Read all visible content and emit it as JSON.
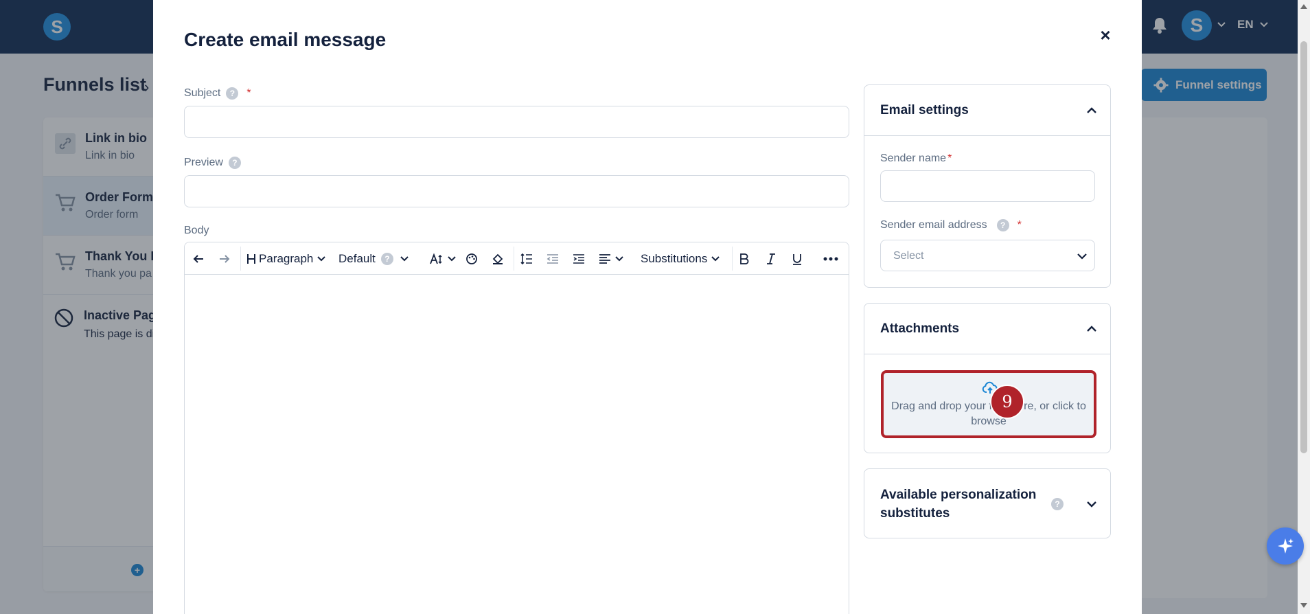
{
  "app": {
    "logo_letter": "S",
    "avatar_letter": "S",
    "language": "EN",
    "breadcrumb_title": "Funnels list",
    "funnel_settings_label": "Funnel settings"
  },
  "sidebar": {
    "items": [
      {
        "title": "Link in bio",
        "subtitle": "Link in bio",
        "icon": "link-icon"
      },
      {
        "title": "Order Form",
        "subtitle": "Order form",
        "icon": "cart-icon"
      },
      {
        "title": "Thank You P",
        "subtitle": "Thank you pa",
        "icon": "cart-icon"
      }
    ],
    "inactive": {
      "title": "Inactive Pag",
      "subtitle": "This page is di disabled",
      "icon": "ban-icon"
    }
  },
  "modal": {
    "title": "Create email message",
    "close_label": "×",
    "subject_label": "Subject",
    "subject_value": "",
    "preview_label": "Preview",
    "preview_value": "",
    "body_label": "Body",
    "toolbar": {
      "heading_label": "Paragraph",
      "font_label": "Default",
      "substitutions_label": "Substitutions"
    }
  },
  "email_settings": {
    "title": "Email settings",
    "sender_name_label": "Sender name",
    "sender_name_value": "",
    "sender_email_label": "Sender email address",
    "sender_email_placeholder": "Select"
  },
  "attachments": {
    "title": "Attachments",
    "dropzone_text": "Drag and drop your files here, or click to browse"
  },
  "personalization": {
    "title": "Available personalization substitutes"
  },
  "annotation": {
    "step_number": "9"
  },
  "colors": {
    "navy": "#0f2a52",
    "primary_blue": "#1b86d4",
    "highlight_red": "#b0232a"
  }
}
